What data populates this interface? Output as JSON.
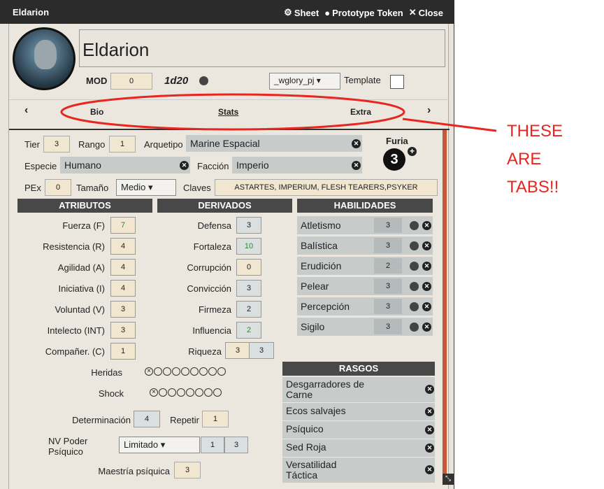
{
  "window": {
    "title": "Eldarion",
    "actions": [
      "Sheet",
      "Prototype Token",
      "Close"
    ]
  },
  "name": "Eldarion",
  "mod": {
    "label": "MOD",
    "value": "0"
  },
  "dice": "1d20",
  "sheet_select": "_wglory_pj",
  "template_label": "Template",
  "tabs": [
    "Bio",
    "Stats",
    "Extra"
  ],
  "tier": {
    "label": "Tier",
    "value": "3"
  },
  "rango": {
    "label": "Rango",
    "value": "1"
  },
  "arquetipo": {
    "label": "Arquetipo",
    "value": "Marine Espacial"
  },
  "especie": {
    "label": "Especie",
    "value": "Humano"
  },
  "faccion": {
    "label": "Facción",
    "value": "Imperio"
  },
  "pex": {
    "label": "PEx",
    "value": "0"
  },
  "tamano": {
    "label": "Tamaño",
    "value": "Medio"
  },
  "claves": {
    "label": "Claves",
    "value": "ASTARTES, IMPERIUM, FLESH TEARERS,PSYKER"
  },
  "furia": {
    "label": "Furia",
    "value": "3"
  },
  "headers": {
    "atributos": "ATRIBUTOS",
    "derivados": "DERIVADOS",
    "habilidades": "HABILIDADES",
    "rasgos": "RASGOS"
  },
  "atributos": [
    {
      "label": "Fuerza (F)",
      "value": "7"
    },
    {
      "label": "Resistencia (R)",
      "value": "4"
    },
    {
      "label": "Agilidad (A)",
      "value": "4"
    },
    {
      "label": "Iniciativa (I)",
      "value": "4"
    },
    {
      "label": "Voluntad (V)",
      "value": "3"
    },
    {
      "label": "Intelecto (INT)",
      "value": "3"
    },
    {
      "label": "Compañer. (C)",
      "value": "1"
    }
  ],
  "derivados": [
    {
      "label": "Defensa",
      "value": "3"
    },
    {
      "label": "Fortaleza",
      "value": "10"
    },
    {
      "label": "Corrupción",
      "value": "0"
    },
    {
      "label": "Convicción",
      "value": "3"
    },
    {
      "label": "Firmeza",
      "value": "2"
    },
    {
      "label": "Influencia",
      "value": "2"
    }
  ],
  "riqueza": {
    "label": "Riqueza",
    "value1": "3",
    "value2": "3"
  },
  "habilidades": [
    {
      "label": "Atletismo",
      "value": "3"
    },
    {
      "label": "Balística",
      "value": "3"
    },
    {
      "label": "Erudición",
      "value": "2"
    },
    {
      "label": "Pelear",
      "value": "3"
    },
    {
      "label": "Percepción",
      "value": "3"
    },
    {
      "label": "Sigilo",
      "value": "3"
    }
  ],
  "heridas": {
    "label": "Heridas",
    "total": 9
  },
  "shock": {
    "label": "Shock",
    "total": 8
  },
  "determinacion": {
    "label": "Determinación",
    "value": "4"
  },
  "repetir": {
    "label": "Repetir",
    "value": "1"
  },
  "nv_poder": {
    "label": "NV Poder Psíquico",
    "select": "Limitado",
    "value1": "1",
    "value2": "3"
  },
  "maestria": {
    "label": "Maestría psíquica",
    "value": "3"
  },
  "rasgos": [
    "Desgarradores de Carne",
    "Ecos salvajes",
    "Psíquico",
    "Sed Roja",
    "Versatilidad Táctica"
  ],
  "annotation": [
    "THESE",
    "ARE",
    "TABS!!"
  ]
}
